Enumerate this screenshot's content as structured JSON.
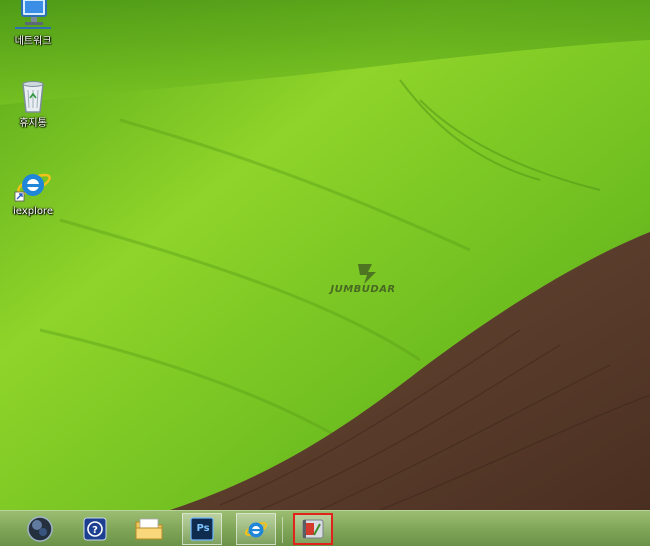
{
  "desktop": {
    "icons": [
      {
        "name": "network-icon",
        "label": "네트워크"
      },
      {
        "name": "recycle-bin-icon",
        "label": "휴지통"
      },
      {
        "name": "internet-explorer-icon",
        "label": "iexplore"
      }
    ],
    "watermark": "JUMBUDAR"
  },
  "taskbar": {
    "buttons": [
      {
        "name": "start-orb-button",
        "icon": "start-orb-icon"
      },
      {
        "name": "help-button",
        "icon": "help-icon"
      },
      {
        "name": "file-explorer-button",
        "icon": "folder-icon"
      },
      {
        "name": "photoshop-button",
        "icon": "photoshop-icon",
        "text": "Ps"
      },
      {
        "name": "internet-explorer-button",
        "icon": "internet-explorer-icon"
      },
      {
        "name": "video-app-button",
        "icon": "film-app-icon"
      }
    ]
  },
  "colors": {
    "grass": "#6cc21f",
    "soil": "#5a3b2a",
    "taskbar": "#7ea457",
    "highlight_border": "#e0241b"
  }
}
